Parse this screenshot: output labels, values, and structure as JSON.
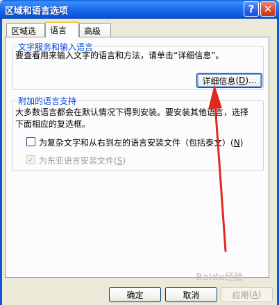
{
  "window": {
    "title": "区域和语言选项",
    "help_glyph": "?",
    "close_glyph": "✕"
  },
  "tabs": [
    {
      "label": "区域选项"
    },
    {
      "label": "语言"
    },
    {
      "label": "高级"
    }
  ],
  "text_services": {
    "title": "文字服务和输入语言",
    "description": "要查看用来输入文字的语言和方法，请单击“详细信息”。",
    "details_button": {
      "label": "详细信息",
      "mnemonic": "D",
      "prefix": "(",
      "suffix": ")..."
    }
  },
  "supplemental": {
    "title": "附加的语言支持",
    "description_line1": "大多数语言都会在默认情况下得到安装。要安装其他语言，选择",
    "description_line2": "下面相应的复选框。",
    "complex_script": {
      "label": "为复杂文字和从右到左的语言安装文件（包括泰文）",
      "mnemonic": "N",
      "checked": false
    },
    "east_asian": {
      "label": "为东亚语言安装文件",
      "mnemonic": "S",
      "checked": true,
      "disabled": true,
      "check_glyph": "✓"
    }
  },
  "footer": {
    "ok_label": "确定",
    "cancel_label": "取消",
    "apply_label": "应用",
    "apply_mnemonic": "A"
  },
  "watermark": "Baidu经验",
  "colors": {
    "titlebar": "#1d6df2",
    "group_title": "#0046d5",
    "annotation_arrow": "#e0281e"
  }
}
